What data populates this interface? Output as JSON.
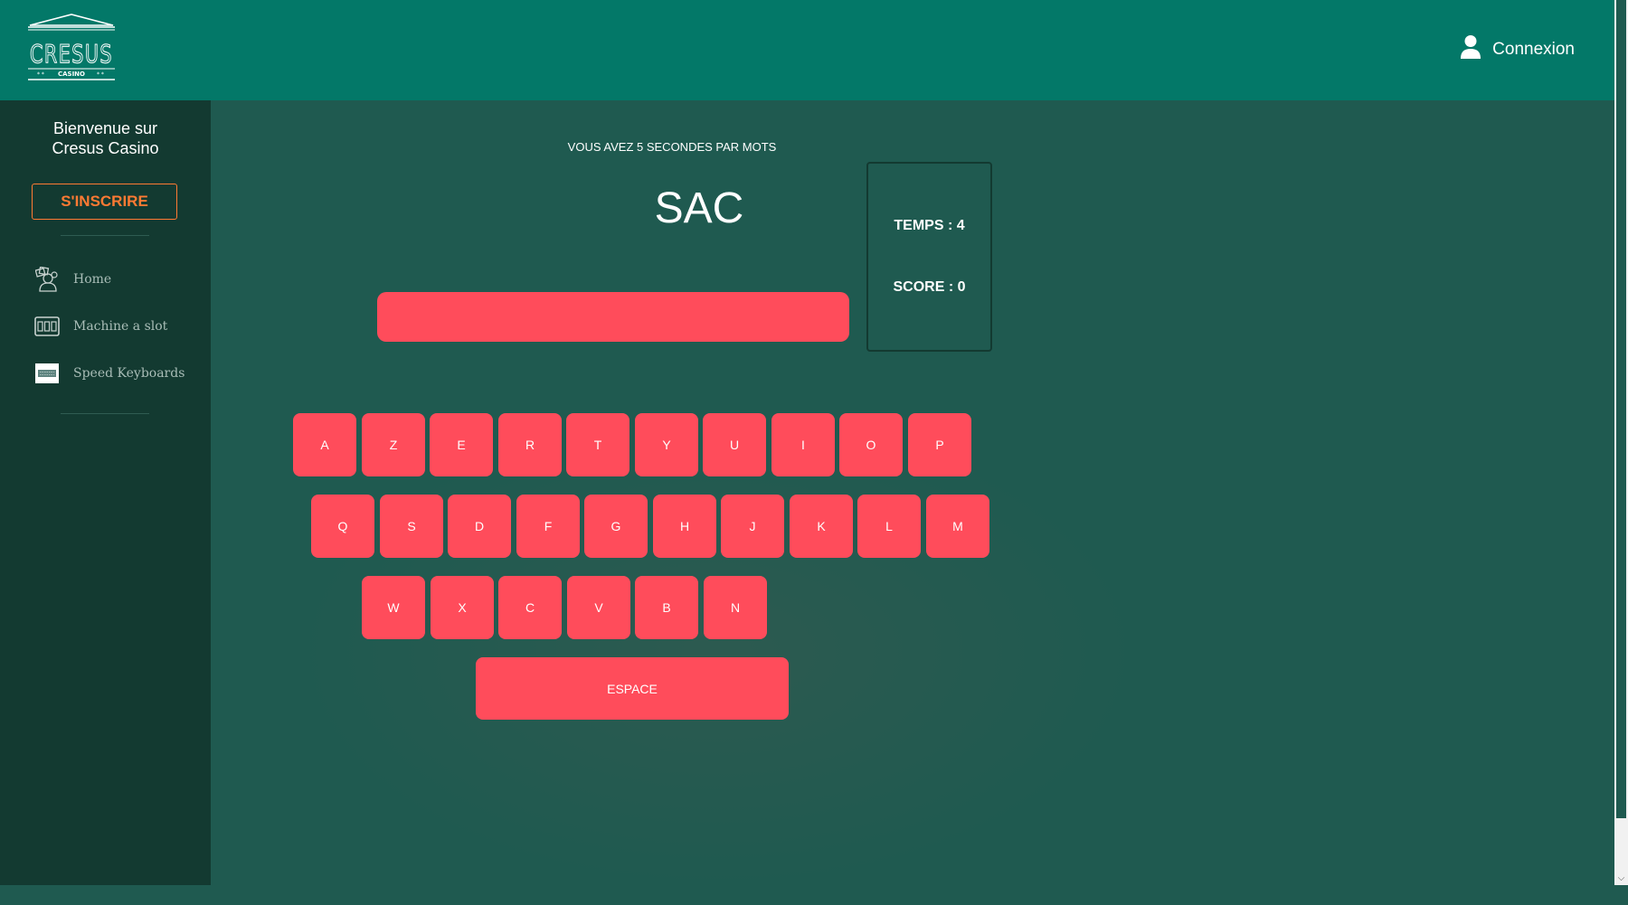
{
  "brand": {
    "logo_main": "CRESUS",
    "logo_sub": "CASINO"
  },
  "header": {
    "connexion_label": "Connexion",
    "user_icon": "user-icon"
  },
  "sidebar": {
    "welcome_line1": "Bienvenue sur",
    "welcome_line2": "Cresus Casino",
    "signup_label": "S'INSCRIRE",
    "items": [
      {
        "label": "Home",
        "icon": "casino-player-icon"
      },
      {
        "label": "Machine a slot",
        "icon": "slot-machine-icon"
      },
      {
        "label": "Speed Keyboards",
        "icon": "keyboard-icon"
      }
    ]
  },
  "game": {
    "instructions": "VOUS AVEZ 5 SECONDES PAR MOTS",
    "word": "SAC",
    "input_value": "",
    "temps_label": "TEMPS : 4",
    "score_label": "SCORE : 0"
  },
  "keyboard": {
    "row1": [
      "A",
      "Z",
      "E",
      "R",
      "T",
      "Y",
      "U",
      "I",
      "O",
      "P"
    ],
    "row2": [
      "Q",
      "S",
      "D",
      "F",
      "G",
      "H",
      "J",
      "K",
      "L",
      "M"
    ],
    "row3": [
      "W",
      "X",
      "C",
      "V",
      "B",
      "N"
    ],
    "space_label": "ESPACE"
  },
  "colors": {
    "header": "#037868",
    "sidebar": "#133a31",
    "main": "#1f5a50",
    "key": "#ff4c5b",
    "accent": "#ff7a33"
  }
}
